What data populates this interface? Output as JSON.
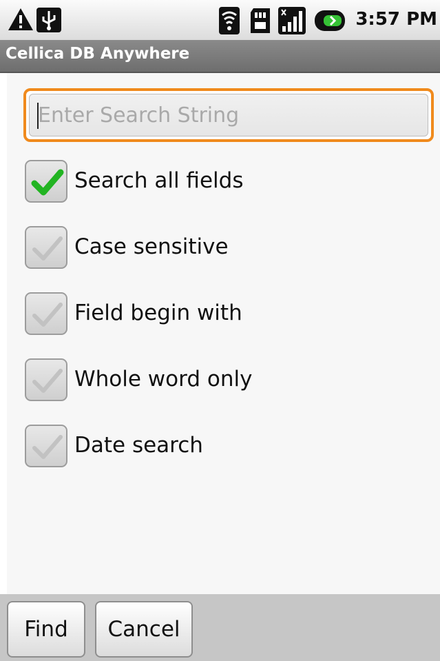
{
  "status_bar": {
    "time": "3:57 PM",
    "icons": [
      "warning-icon",
      "usb-icon",
      "wifi-icon",
      "sd-card-icon",
      "signal-icon",
      "battery-icon"
    ]
  },
  "app": {
    "title": "Cellica DB Anywhere"
  },
  "search": {
    "placeholder": "Enter Search String",
    "value": ""
  },
  "options": [
    {
      "label": "Search all fields",
      "checked": true
    },
    {
      "label": "Case sensitive",
      "checked": false
    },
    {
      "label": "Field begin with",
      "checked": false
    },
    {
      "label": "Whole word only",
      "checked": false
    },
    {
      "label": "Date search",
      "checked": false
    }
  ],
  "buttons": {
    "find": "Find",
    "cancel": "Cancel"
  },
  "colors": {
    "focus": "#f08a1c",
    "check_on": "#22b422",
    "title_bar": "#7a7a7a"
  }
}
